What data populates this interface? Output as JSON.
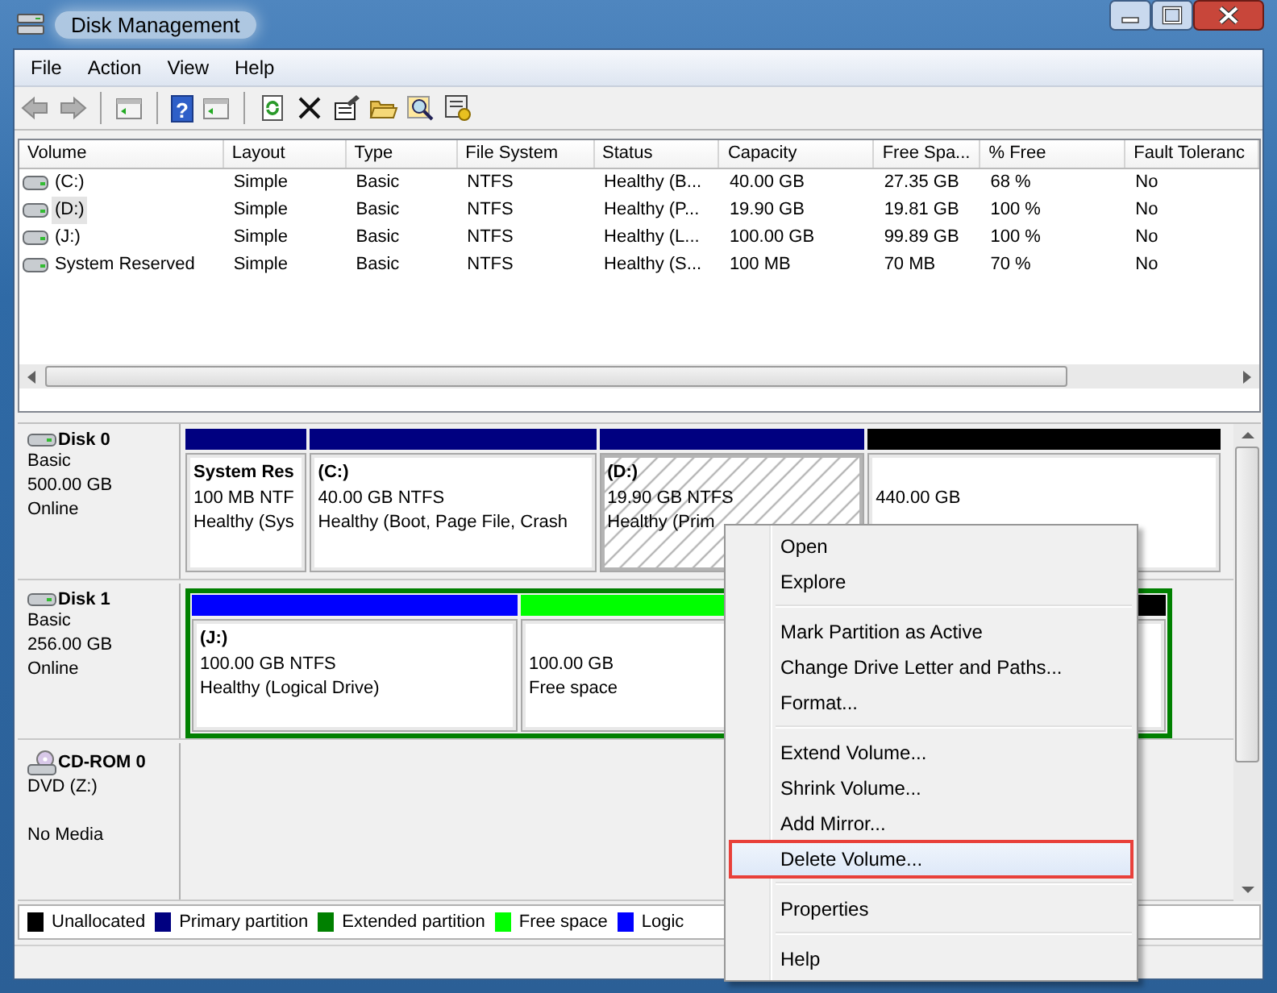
{
  "window": {
    "title": "Disk Management"
  },
  "menu_bar": [
    "File",
    "Action",
    "View",
    "Help"
  ],
  "toolbar": [
    {
      "kind": "back",
      "disabled": true
    },
    {
      "kind": "forward",
      "disabled": true
    },
    {
      "kind": "tree"
    },
    {
      "kind": "help",
      "glyph": "?"
    },
    {
      "kind": "pane"
    },
    {
      "kind": "refresh"
    },
    {
      "kind": "delete"
    },
    {
      "kind": "properties"
    },
    {
      "kind": "open"
    },
    {
      "kind": "search"
    },
    {
      "kind": "settings"
    }
  ],
  "volume_table": {
    "columns": [
      "Volume",
      "Layout",
      "Type",
      "File System",
      "Status",
      "Capacity",
      "Free Spa...",
      "% Free",
      "Fault Toleranc"
    ],
    "rows": [
      {
        "selected": false,
        "cells": [
          "(C:)",
          "Simple",
          "Basic",
          "NTFS",
          "Healthy (B...",
          "40.00 GB",
          "27.35 GB",
          "68 %",
          "No"
        ]
      },
      {
        "selected": true,
        "cells": [
          "(D:)",
          "Simple",
          "Basic",
          "NTFS",
          "Healthy (P...",
          "19.90 GB",
          "19.81 GB",
          "100 %",
          "No"
        ]
      },
      {
        "selected": false,
        "cells": [
          "(J:)",
          "Simple",
          "Basic",
          "NTFS",
          "Healthy (L...",
          "100.00 GB",
          "99.89 GB",
          "100 %",
          "No"
        ]
      },
      {
        "selected": false,
        "cells": [
          "System Reserved",
          "Simple",
          "Basic",
          "NTFS",
          "Healthy (S...",
          "100 MB",
          "70 MB",
          "70 %",
          "No"
        ]
      }
    ]
  },
  "disks": [
    {
      "kind": "hdd",
      "name": "Disk 0",
      "type": "Basic",
      "size": "500.00 GB",
      "status": "Online",
      "partitions": [
        {
          "kind": "partition",
          "color": "#000080",
          "selected": false,
          "title": "System Res",
          "lines": [
            "100 MB NTF",
            "Healthy (Sys"
          ]
        },
        {
          "kind": "partition",
          "color": "#000080",
          "selected": false,
          "title": "(C:)",
          "lines": [
            "40.00 GB NTFS",
            "Healthy (Boot, Page File, Crash"
          ]
        },
        {
          "kind": "partition",
          "color": "#000080",
          "selected": true,
          "title": "(D:)",
          "lines": [
            "19.90 GB NTFS",
            "Healthy (Prim"
          ]
        },
        {
          "kind": "partition",
          "color": "#000000",
          "selected": false,
          "lines": [
            "440.00 GB"
          ]
        }
      ]
    },
    {
      "kind": "hdd",
      "name": "Disk 1",
      "type": "Basic",
      "size": "256.00 GB",
      "status": "Online",
      "partitions": [
        {
          "kind": "extended",
          "color": "#008000",
          "partitions": [
            {
              "color": "#0000ff",
              "selected": false,
              "title": "(J:)",
              "lines": [
                "100.00 GB NTFS",
                "Healthy (Logical Drive)"
              ]
            },
            {
              "color": "#00ff00",
              "selected": false,
              "lines": [
                "100.00 GB",
                "Free space"
              ]
            },
            {
              "color": "#000000",
              "selected": false
            }
          ]
        }
      ]
    },
    {
      "kind": "cdrom",
      "name": "CD-ROM 0",
      "type": "DVD (Z:)",
      "status": "No Media"
    }
  ],
  "legend": [
    {
      "color": "#000000",
      "label": "Unallocated"
    },
    {
      "color": "#000080",
      "label": "Primary partition"
    },
    {
      "color": "#008000",
      "label": "Extended partition"
    },
    {
      "color": "#00ff00",
      "label": "Free space"
    },
    {
      "color": "#0000ff",
      "label": "Logic"
    }
  ],
  "context_menu": [
    {
      "kind": "item",
      "label": "Open",
      "selected": false
    },
    {
      "kind": "item",
      "label": "Explore",
      "selected": false
    },
    {
      "kind": "separator"
    },
    {
      "kind": "item",
      "label": "Mark Partition as Active",
      "selected": false
    },
    {
      "kind": "item",
      "label": "Change Drive Letter and Paths...",
      "selected": false
    },
    {
      "kind": "item",
      "label": "Format...",
      "selected": false
    },
    {
      "kind": "separator"
    },
    {
      "kind": "item",
      "label": "Extend Volume...",
      "selected": false
    },
    {
      "kind": "item",
      "label": "Shrink Volume...",
      "selected": false
    },
    {
      "kind": "item",
      "label": "Add Mirror...",
      "selected": false
    },
    {
      "kind": "item",
      "label": "Delete Volume...",
      "selected": true
    },
    {
      "kind": "separator"
    },
    {
      "kind": "item",
      "label": "Properties",
      "selected": false
    },
    {
      "kind": "separator"
    },
    {
      "kind": "item",
      "label": "Help",
      "selected": false
    }
  ]
}
